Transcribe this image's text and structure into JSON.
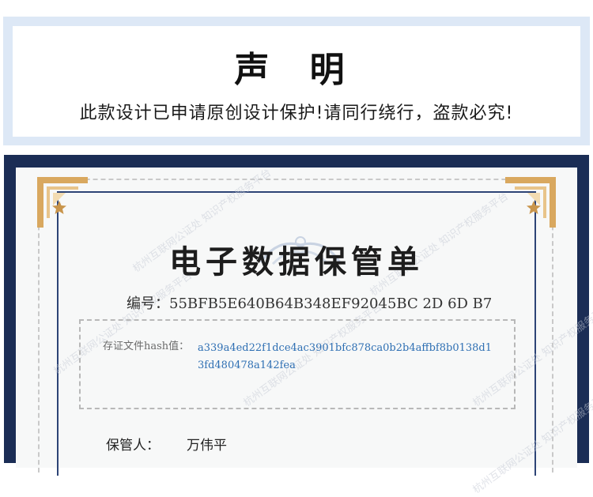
{
  "notice": {
    "title": "声 明",
    "text": "此款设计已申请原创设计保护!请同行绕行，盗款必究!"
  },
  "certificate": {
    "title": "电子数据保管单",
    "number_label": "编号：",
    "number_value": "55BFB5E640B64B348EF92045BC 2D 6D B7",
    "hash_label": "存证文件hash值：",
    "hash_value": "a339a4ed22f1dce4ac3901bfc878ca0b2b4affbf8b0138d13fd480478a142fea",
    "keeper_label": "保管人：",
    "keeper_value": "万伟平",
    "watermark": "杭州互联网公证处 知识产权服务平台",
    "colors": {
      "frame": "#1b2d55",
      "gold": "#d9a85f",
      "hash": "#2e6fb3"
    }
  }
}
